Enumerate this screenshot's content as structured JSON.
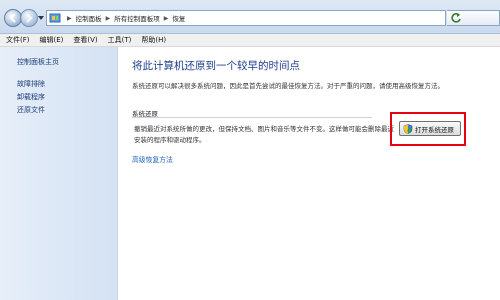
{
  "address_bar": {
    "crumbs": [
      "控制面板",
      "所有控制面板项",
      "恢复"
    ]
  },
  "menu": {
    "items": [
      "文件(F)",
      "编辑(E)",
      "查看(V)",
      "工具(T)",
      "帮助(H)"
    ]
  },
  "sidebar": {
    "items": [
      {
        "label": "控制面板主页"
      },
      {
        "label": "故障排除"
      },
      {
        "label": "卸载程序"
      },
      {
        "label": "还原文件"
      }
    ]
  },
  "main": {
    "title": "将此计算机还原到一个较早的时间点",
    "description": "系统还原可以解决很多系统问题，因此是首先尝试的最佳恢复方法。对于严重的问题，请使用高级恢复方法。",
    "group_label": "系统还原",
    "group_text": "撤销最近对系统所做的更改，但保持文档、图片和音乐等文件不变。这样做可能会删除最近安装的程序和驱动程序。",
    "open_button_label": "打开系统还原",
    "advanced_link": "高级恢复方法"
  },
  "colors": {
    "highlight_border": "#e60012",
    "title": "#1e3e8a",
    "link": "#1e63b8"
  },
  "icons": {
    "address": "control-panel-icon",
    "button": "system-restore-shield-icon"
  }
}
